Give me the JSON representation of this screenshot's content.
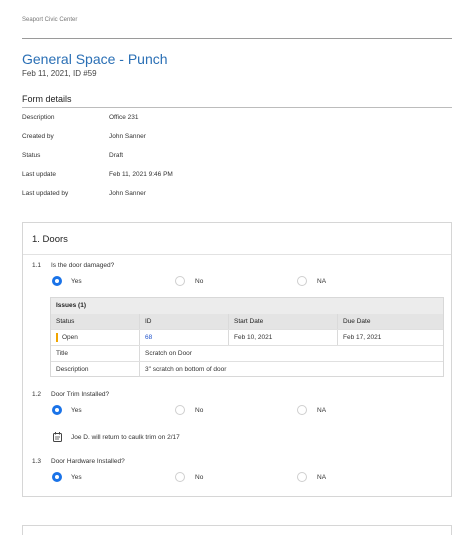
{
  "header": {
    "project": "Seaport Civic Center",
    "title": "General Space - Punch",
    "subtitle": "Feb 11, 2021, ID #59"
  },
  "form_details": {
    "heading": "Form details",
    "rows": [
      {
        "label": "Description",
        "value": "Office 231"
      },
      {
        "label": "Created by",
        "value": "John Sanner"
      },
      {
        "label": "Status",
        "value": "Draft"
      },
      {
        "label": "Last update",
        "value": "Feb 11, 2021 9:46 PM"
      },
      {
        "label": "Last updated by",
        "value": "John Sanner"
      }
    ]
  },
  "section": {
    "title": "1. Doors",
    "questions": [
      {
        "num": "1.1",
        "text": "Is the door damaged?",
        "options": [
          "Yes",
          "No",
          "NA"
        ],
        "selected": "Yes"
      },
      {
        "num": "1.2",
        "text": "Door Trim Installed?",
        "options": [
          "Yes",
          "No",
          "NA"
        ],
        "selected": "Yes",
        "note": "Joe D. will return to caulk trim on 2/17"
      },
      {
        "num": "1.3",
        "text": "Door Hardware Installed?",
        "options": [
          "Yes",
          "No",
          "NA"
        ],
        "selected": "Yes"
      }
    ],
    "issues": {
      "heading": "Issues (1)",
      "columns": [
        "Status",
        "ID",
        "Start Date",
        "Due Date"
      ],
      "row": {
        "status": "Open",
        "id": "68",
        "start": "Feb 10, 2021",
        "due": "Feb 17, 2021",
        "status_color": "#f0a500"
      },
      "title_label": "Title",
      "title_value": "Scratch on Door",
      "desc_label": "Description",
      "desc_value": "3\" scratch on bottom of door"
    }
  },
  "colors": {
    "accent": "#1a73e8",
    "title": "#2a6fb5",
    "link": "#2255cc"
  }
}
